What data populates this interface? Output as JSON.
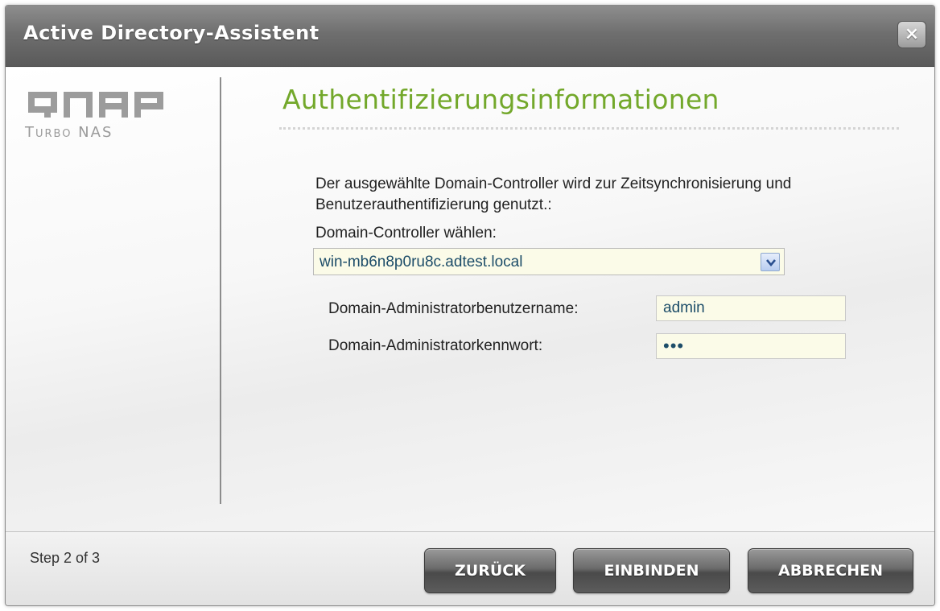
{
  "window": {
    "title": "Active Directory-Assistent",
    "close_glyph": "×"
  },
  "brand": {
    "logo_text": "QNAP",
    "sub_text": "Turbo NAS",
    "accent_color": "#73a82b"
  },
  "main": {
    "heading": "Authentifizierungsinformationen",
    "description": "Der ausgewählte Domain-Controller wird zur Zeitsynchronisierung und Benutzerauthentifizierung genutzt.:",
    "dc_label": "Domain-Controller wählen:",
    "dc_selected": "win-mb6n8p0ru8c.adtest.local",
    "username_label": "Domain-Administratorbenutzername:",
    "username_value": "admin",
    "password_label": "Domain-Administratorkennwort:",
    "password_value": "abc"
  },
  "footer": {
    "step": "Step 2 of 3",
    "back_label": "ZURÜCK",
    "join_label": "EINBINDEN",
    "cancel_label": "ABBRECHEN"
  },
  "icons": {
    "close": "close-icon",
    "dropdown": "chevron-down-icon"
  }
}
